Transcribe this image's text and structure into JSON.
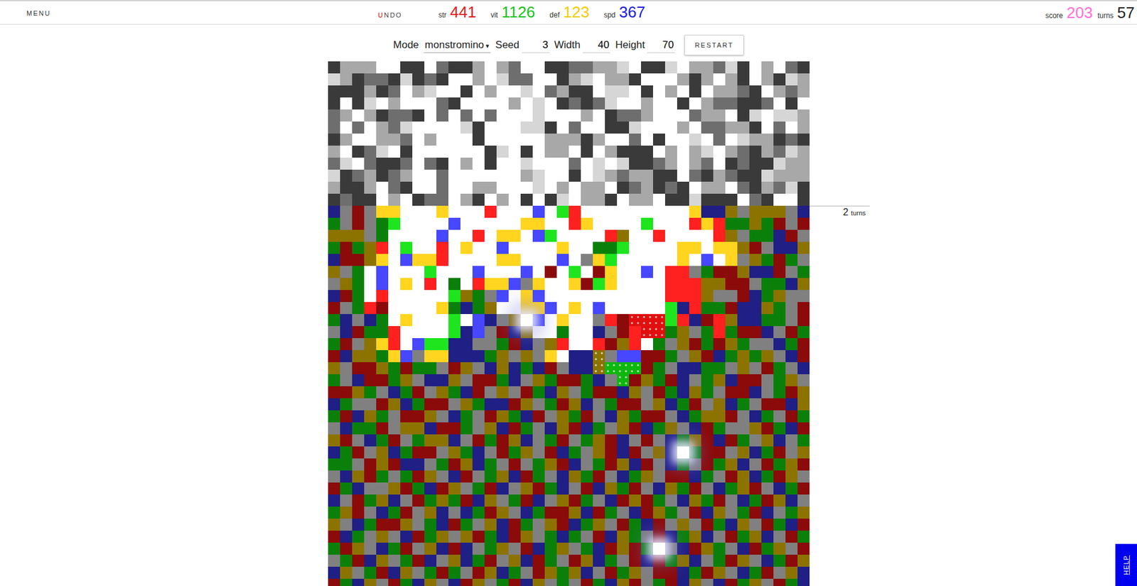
{
  "topbar": {
    "menu": "MENU",
    "undo": {
      "first": "U",
      "rest": "NDO"
    },
    "stats": [
      {
        "label": "str",
        "value": "441",
        "color": "#e41a1a"
      },
      {
        "label": "vit",
        "value": "1126",
        "color": "#17c417"
      },
      {
        "label": "def",
        "value": "123",
        "color": "#f2cc00"
      },
      {
        "label": "spd",
        "value": "367",
        "color": "#1a1ae8"
      }
    ],
    "score": {
      "label": "score",
      "value": "203",
      "color": "#ff6fd8"
    },
    "turns": {
      "label": "turns",
      "value": "57"
    }
  },
  "controls": {
    "mode_label": "Mode",
    "mode_value": "monstromino",
    "mode_arrow": "▾",
    "seed_label": "Seed",
    "seed_value": "3",
    "width_label": "Width",
    "width_value": "40",
    "height_label": "Height",
    "height_value": "70",
    "restart": "RESTART"
  },
  "horizon": {
    "count": "2",
    "unit": "turns"
  },
  "help": "HELP",
  "board": {
    "palette": {
      "0": {
        "color": "#ffffff",
        "kind": "plain"
      },
      "1": {
        "color": "#d6d6d6",
        "kind": "plain"
      },
      "2": {
        "color": "#a8a8a8",
        "kind": "plain"
      },
      "3": {
        "color": "#6e6e6e",
        "kind": "plain"
      },
      "4": {
        "color": "#3a3a3a",
        "kind": "plain"
      },
      "N": {
        "color": "#1f1f85",
        "kind": "plain"
      },
      "R": {
        "color": "#8b0a0a",
        "kind": "plain"
      },
      "G": {
        "color": "#0a800a",
        "kind": "plain"
      },
      "O": {
        "color": "#8c7300",
        "kind": "plain"
      },
      "S": {
        "color": "#808080",
        "kind": "plain"
      },
      "W": {
        "color": "#ffffff",
        "kind": "plain"
      },
      "Y": {
        "color": "#ffd520",
        "kind": "plain"
      },
      "L": {
        "color": "#1ee51e",
        "kind": "plain"
      },
      "B": {
        "color": "#4747ff",
        "kind": "plain"
      },
      "E": {
        "color": "#ff2020",
        "kind": "plain"
      },
      "o": {
        "color": "#8c7300",
        "kind": "marked"
      },
      "g": {
        "color": "#0fb70f",
        "kind": "marked"
      },
      "e": {
        "color": "#e01010",
        "kind": "marked"
      },
      "*": {
        "color": "#ffffff",
        "kind": "glow"
      }
    },
    "rows": [
      "4222004403442023004433221044102231402034",
      "1243341434002013300421022400024202402412",
      "4442430210040200103244011040204022340232",
      "4041020003400002010434310020040233443040",
      "3202433403030300010002043320003220410112",
      "3030231000014000114030044100020332240302",
      "4200223020004000002224200304001030122434",
      "2043104000000410402204024440202102342312",
      "3103443034020400100030101443202304344122",
      "1432432003000000210040123224403423441222",
      "2442034003002200010202204324340220342314",
      "4344020433024020404102240220441444034004",
      "NSRSYYWWWYWWWEWWWBWLEWWWWWWWWWYNNOSOOOSN",
      "GSRSGLWWWWBWWWWWYYWWEYWWWWLWWWEYEGGOGRSR",
      "OOOSGWWWWBWWEWYYWBLWWWWEOWWEWWWWEOSGGNRS",
      "GRGOEWLWWEWYWWBWWWWYWWGGLWWWWYYWYYORSNNO",
      "NRROYWBYYEWWWWYYWWWBWSYLWWWWWYWBWYSOGRGS",
      "OSGWBWWWLWWWBWWWBWRWLWRYWWBWEESGRRONNRSG",
      "SOGWBWYWEWGWEYYBSYWWYRLYWWWWEEEOORRSGGNO",
      "NRGWEWWWWWLOGSBWYBWWWWWWWWWWEEEOSSRNGOSS",
      "RSGERWWWWYGNGOWWYYBWYWBWWWWWLNEGGRNNOGSR",
      "GNSNGWYWWWLWBNSO*BWYWWSEReeeLENREONNGGSR",
      "SNRGGEWWWWLNBSRNOWWGWWNSREeeGOSGEGRRNSRG",
      "GRSOYEWBLLNNSSGRNSOEWWEROEWGSORGROGSSNGR",
      "RNOOGYBSYYNNNGOSOSYWNNoSBBRRGSORNGOGOSNR",
      "OSRROGRGGSROSNONGNRSNNogggRGSNNGGSOSRGSN",
      "GSNRRGOSNNOSRRGNSOGRRGNSgROGRNSGONRRSGOS",
      "RROGSNGRSOGNRSOSRGNOSGRRNOSRGNOGSRRNSGRO",
      "NGSSRONGRRSOGNNROSGRONSGRRSONGRSONGSRRNO",
      "GRNOGSRROSNGSROGNRSOGRSNOGRRSNGOORSNGSRG",
      "SNGGRSOONRRGSONRGSNORNGSORNGOSNRGSSORGNR",
      "ORSNGRSGOONSRGRONSGRSGORNSRSNGORNRGSONSG",
      "NGRSONGRRSOGNSRGOSRNGSORNRSON*GRRSONGRSO",
      "GGSRORNNSGRONGSRSGORNSGRONRSNGSRGONSRGOR",
      "SNORGSGROSNRSGONRGSNOGRSNGOSRRNGSRONGROS",
      "RGNSSORGNROSGRNSORGNSRNOGRSNOGRSNGORSNGR",
      "NSRGONSRGOGRNOSGRNSORGSNRORGSNOGRSNGRONS",
      "GORSNGRSONSNGROSNGRRONRGSNROGSRNOSGRNSGO",
      "OSNGRROSGNRGSONRGSORNGOSRGNRSOSRGNOSRGNR",
      "RNGSOSNRGOSORGNROSGNGSRNOGSRNGONSRGONSRG",
      "GROSNGRSONRNSGOSRNGOSGNRORG*SNROGSNRGOSR",
      "SGRNOSGRNSONGRSONRGSRONGSRNRGONSGROSNGRO",
      "NOSGRNOSGRGSRONGSROGONSRGOSRRNGROSNGRSON",
      "RGNOSRGNOSNROSGRNOSGSRGNORSGRNOSNRGOSRGN"
    ]
  }
}
